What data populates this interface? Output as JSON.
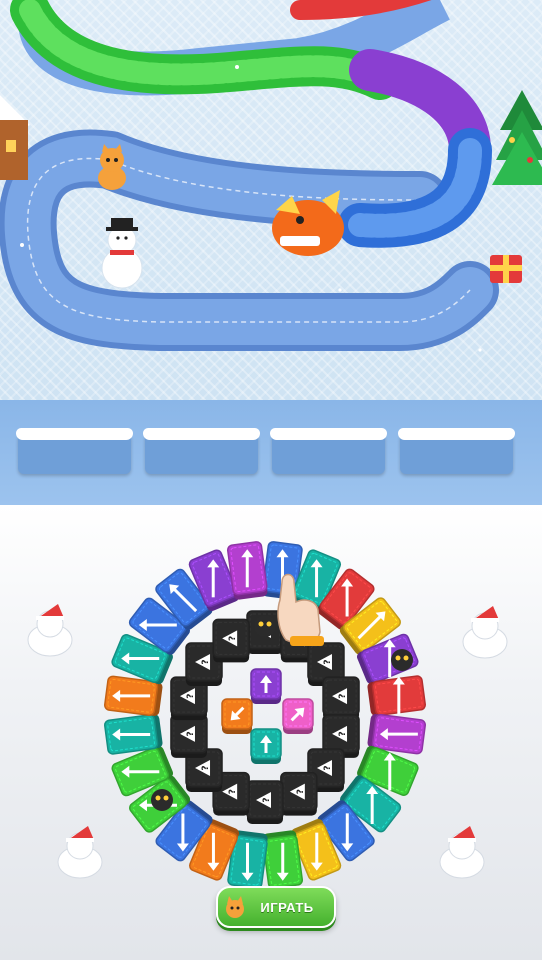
{
  "play_button": {
    "label": "ИГРАТЬ"
  },
  "board": {
    "path_color": "#6c9ae0",
    "decorations": [
      "gingerbread-house-icon",
      "cat-icon",
      "snowman-icon",
      "christmas-tree-icon",
      "gift-box-icon",
      "dragon-head-icon"
    ]
  },
  "queue": {
    "slots": [
      {
        "state": "empty"
      },
      {
        "state": "empty"
      },
      {
        "state": "empty"
      },
      {
        "state": "empty"
      }
    ]
  },
  "colors": {
    "purple": "#8a3fd1",
    "blue": "#3b74e0",
    "teal": "#18b3a4",
    "red": "#e23b3b",
    "yellow": "#f4c01a",
    "magenta": "#b33fcf",
    "orange": "#f27b1c",
    "green": "#3fcf3a",
    "pink": "#ef5fc8",
    "black": "#2a2a2a"
  },
  "outer_ring": [
    {
      "color": "blue",
      "arrow": "up"
    },
    {
      "color": "teal",
      "arrow": "up"
    },
    {
      "color": "red",
      "arrow": "up"
    },
    {
      "color": "yellow",
      "arrow": "up-right"
    },
    {
      "color": "purple",
      "arrow": "right"
    },
    {
      "color": "red",
      "arrow": "right"
    },
    {
      "color": "magenta",
      "arrow": "left"
    },
    {
      "color": "green",
      "arrow": "right"
    },
    {
      "color": "teal",
      "arrow": "right"
    },
    {
      "color": "blue",
      "arrow": "down"
    },
    {
      "color": "yellow",
      "arrow": "down"
    },
    {
      "color": "green",
      "arrow": "down"
    },
    {
      "color": "teal",
      "arrow": "down"
    },
    {
      "color": "orange",
      "arrow": "down"
    },
    {
      "color": "blue",
      "arrow": "down"
    },
    {
      "color": "green",
      "arrow": "left"
    },
    {
      "color": "green",
      "arrow": "left"
    },
    {
      "color": "teal",
      "arrow": "left"
    },
    {
      "color": "orange",
      "arrow": "left"
    },
    {
      "color": "teal",
      "arrow": "left"
    },
    {
      "color": "blue",
      "arrow": "left"
    },
    {
      "color": "blue",
      "arrow": "up-left"
    },
    {
      "color": "purple",
      "arrow": "up"
    },
    {
      "color": "magenta",
      "arrow": "up"
    }
  ],
  "inner_ring": {
    "count": 14,
    "label": "?"
  },
  "center": [
    {
      "color": "purple",
      "arrow": "up"
    },
    {
      "color": "orange",
      "arrow": "down-left"
    },
    {
      "color": "pink",
      "arrow": "up-right"
    },
    {
      "color": "teal",
      "arrow": "up"
    }
  ]
}
